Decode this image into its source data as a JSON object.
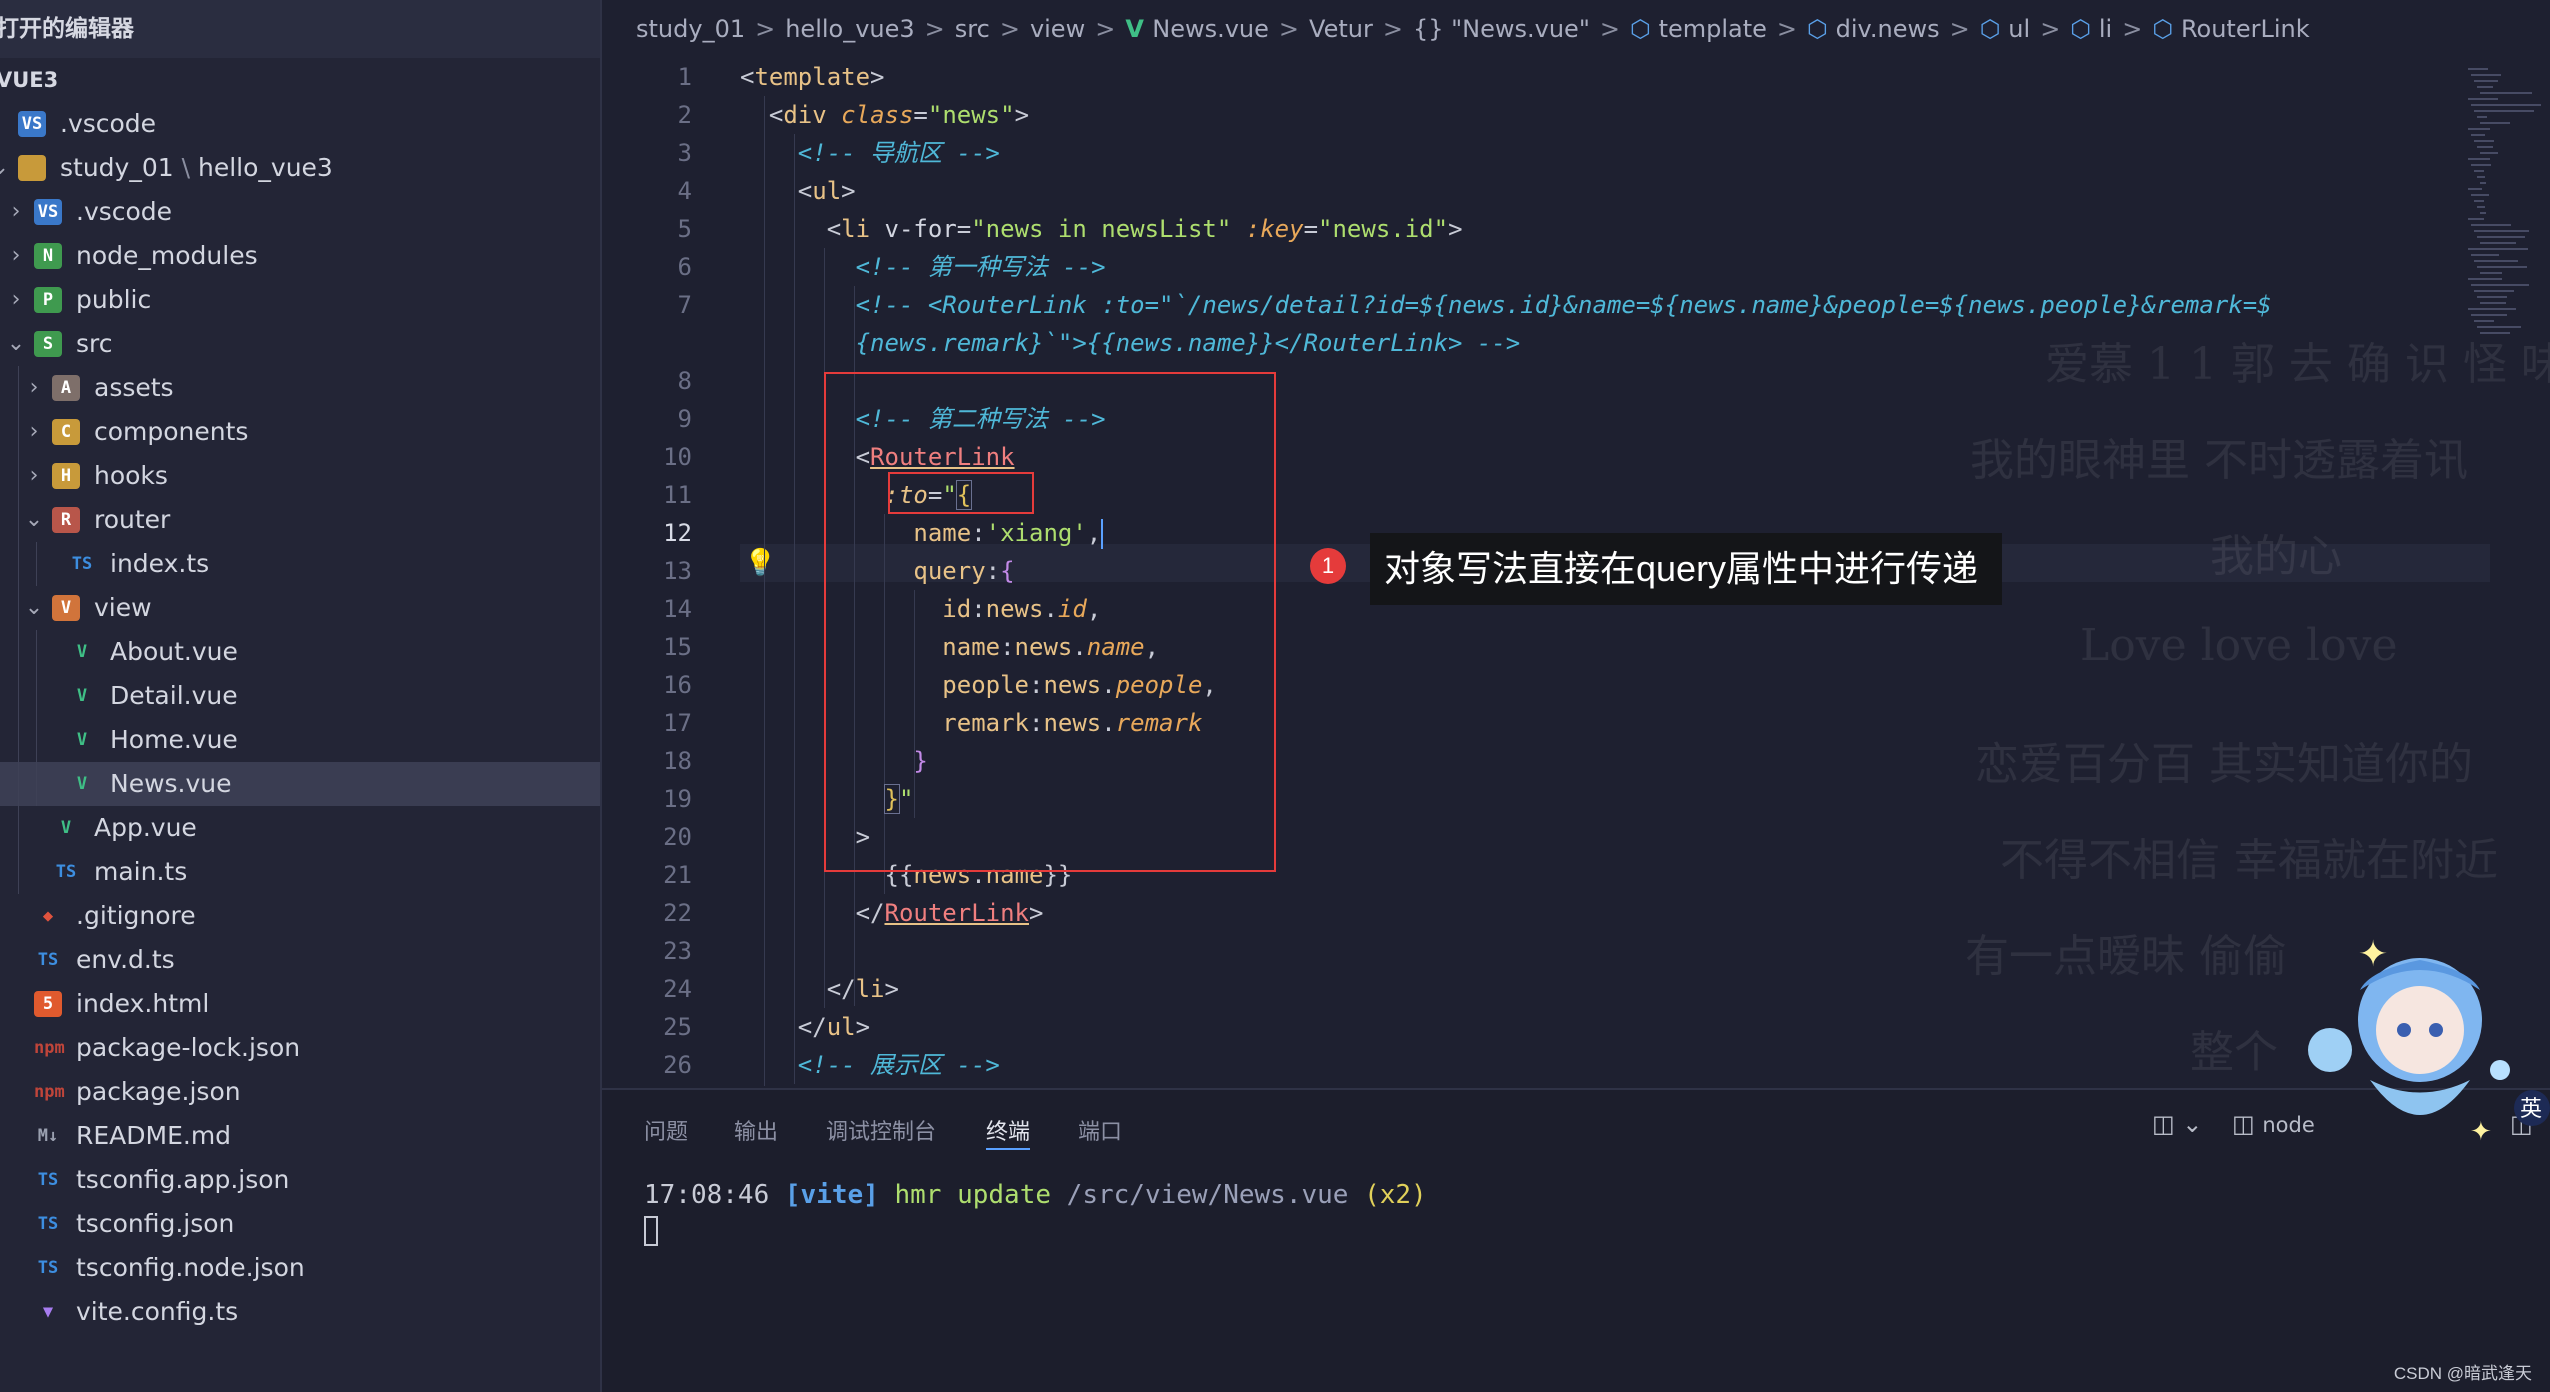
{
  "sidebar": {
    "header": "打开的编辑器",
    "project": "VUE3",
    "items": [
      {
        "label": ".vscode",
        "icon": "vscode-folder-icon",
        "badge": "VS"
      },
      {
        "label": "study_01",
        "suffix": "hello_vue3",
        "icon": "folder-open-icon",
        "badge": ""
      },
      {
        "label": ".vscode",
        "icon": "vscode-folder-icon",
        "badge": "VS"
      },
      {
        "label": "node_modules",
        "icon": "node-folder-icon",
        "badge": "N"
      },
      {
        "label": "public",
        "icon": "public-folder-icon",
        "badge": "P"
      },
      {
        "label": "src",
        "icon": "src-folder-icon",
        "badge": "S"
      },
      {
        "label": "assets",
        "icon": "assets-folder-icon",
        "badge": "A"
      },
      {
        "label": "components",
        "icon": "components-folder-icon",
        "badge": "C"
      },
      {
        "label": "hooks",
        "icon": "hooks-folder-icon",
        "badge": "H"
      },
      {
        "label": "router",
        "icon": "router-folder-icon",
        "badge": "R"
      },
      {
        "label": "index.ts",
        "icon": "typescript-file-icon",
        "badge": "TS"
      },
      {
        "label": "view",
        "icon": "view-folder-icon",
        "badge": "V"
      },
      {
        "label": "About.vue",
        "icon": "vue-file-icon",
        "badge": "V"
      },
      {
        "label": "Detail.vue",
        "icon": "vue-file-icon",
        "badge": "V"
      },
      {
        "label": "Home.vue",
        "icon": "vue-file-icon",
        "badge": "V"
      },
      {
        "label": "News.vue",
        "icon": "vue-file-icon",
        "badge": "V"
      },
      {
        "label": "App.vue",
        "icon": "vue-file-icon",
        "badge": "V"
      },
      {
        "label": "main.ts",
        "icon": "typescript-file-icon",
        "badge": "TS"
      },
      {
        "label": ".gitignore",
        "icon": "git-icon",
        "badge": "◆"
      },
      {
        "label": "env.d.ts",
        "icon": "typescript-def-icon",
        "badge": "TS"
      },
      {
        "label": "index.html",
        "icon": "html-file-icon",
        "badge": "5"
      },
      {
        "label": "package-lock.json",
        "icon": "npm-file-icon",
        "badge": "npm"
      },
      {
        "label": "package.json",
        "icon": "npm-file-icon",
        "badge": "npm"
      },
      {
        "label": "README.md",
        "icon": "markdown-file-icon",
        "badge": "M↓"
      },
      {
        "label": "tsconfig.app.json",
        "icon": "tsconfig-file-icon",
        "badge": "TS"
      },
      {
        "label": "tsconfig.json",
        "icon": "tsconfig-file-icon",
        "badge": "TS"
      },
      {
        "label": "tsconfig.node.json",
        "icon": "tsconfig-file-icon",
        "badge": "TS"
      },
      {
        "label": "vite.config.ts",
        "icon": "vite-file-icon",
        "badge": "▼"
      }
    ]
  },
  "breadcrumb": {
    "parts": [
      "study_01",
      "hello_vue3",
      "src",
      "view",
      "News.vue",
      "Vetur",
      "{} \"News.vue\"",
      "template",
      "div.news",
      "ul",
      "li",
      "RouterLink"
    ],
    "separator": ">"
  },
  "editor": {
    "active_line": 12,
    "line_numbers": [
      "1",
      "2",
      "3",
      "4",
      "5",
      "6",
      "7",
      "",
      "8",
      "9",
      "10",
      "11",
      "12",
      "13",
      "14",
      "15",
      "16",
      "17",
      "18",
      "19",
      "20",
      "21",
      "22",
      "23",
      "24",
      "25",
      "26"
    ]
  },
  "annotation": {
    "number": "1",
    "text": "对象写法直接在query属性中进行传递"
  },
  "lyrics": [
    "我的眼神里 不时透露着讯",
    "我的心",
    "Love love love",
    "恋爱百分百 其实知道你的",
    "不得不相信 幸福就在附近",
    "有一点暧昧 偷偷",
    "整个"
  ],
  "panel": {
    "tabs": [
      "问题",
      "输出",
      "调试控制台",
      "终端",
      "端口"
    ],
    "active_tab": "终端",
    "terminal": {
      "time": "17:08:46",
      "tag": "[vite]",
      "action": "hmr update",
      "path": "/src/view/News.vue",
      "count": "(x2)"
    },
    "shell": "node",
    "ime": "英"
  },
  "watermark": "CSDN @暗武逢天",
  "colors": {
    "background": "#1e2030",
    "sidebar": "#232536",
    "highlight_red": "#e53b3b",
    "annotation_bg": "#141518"
  }
}
